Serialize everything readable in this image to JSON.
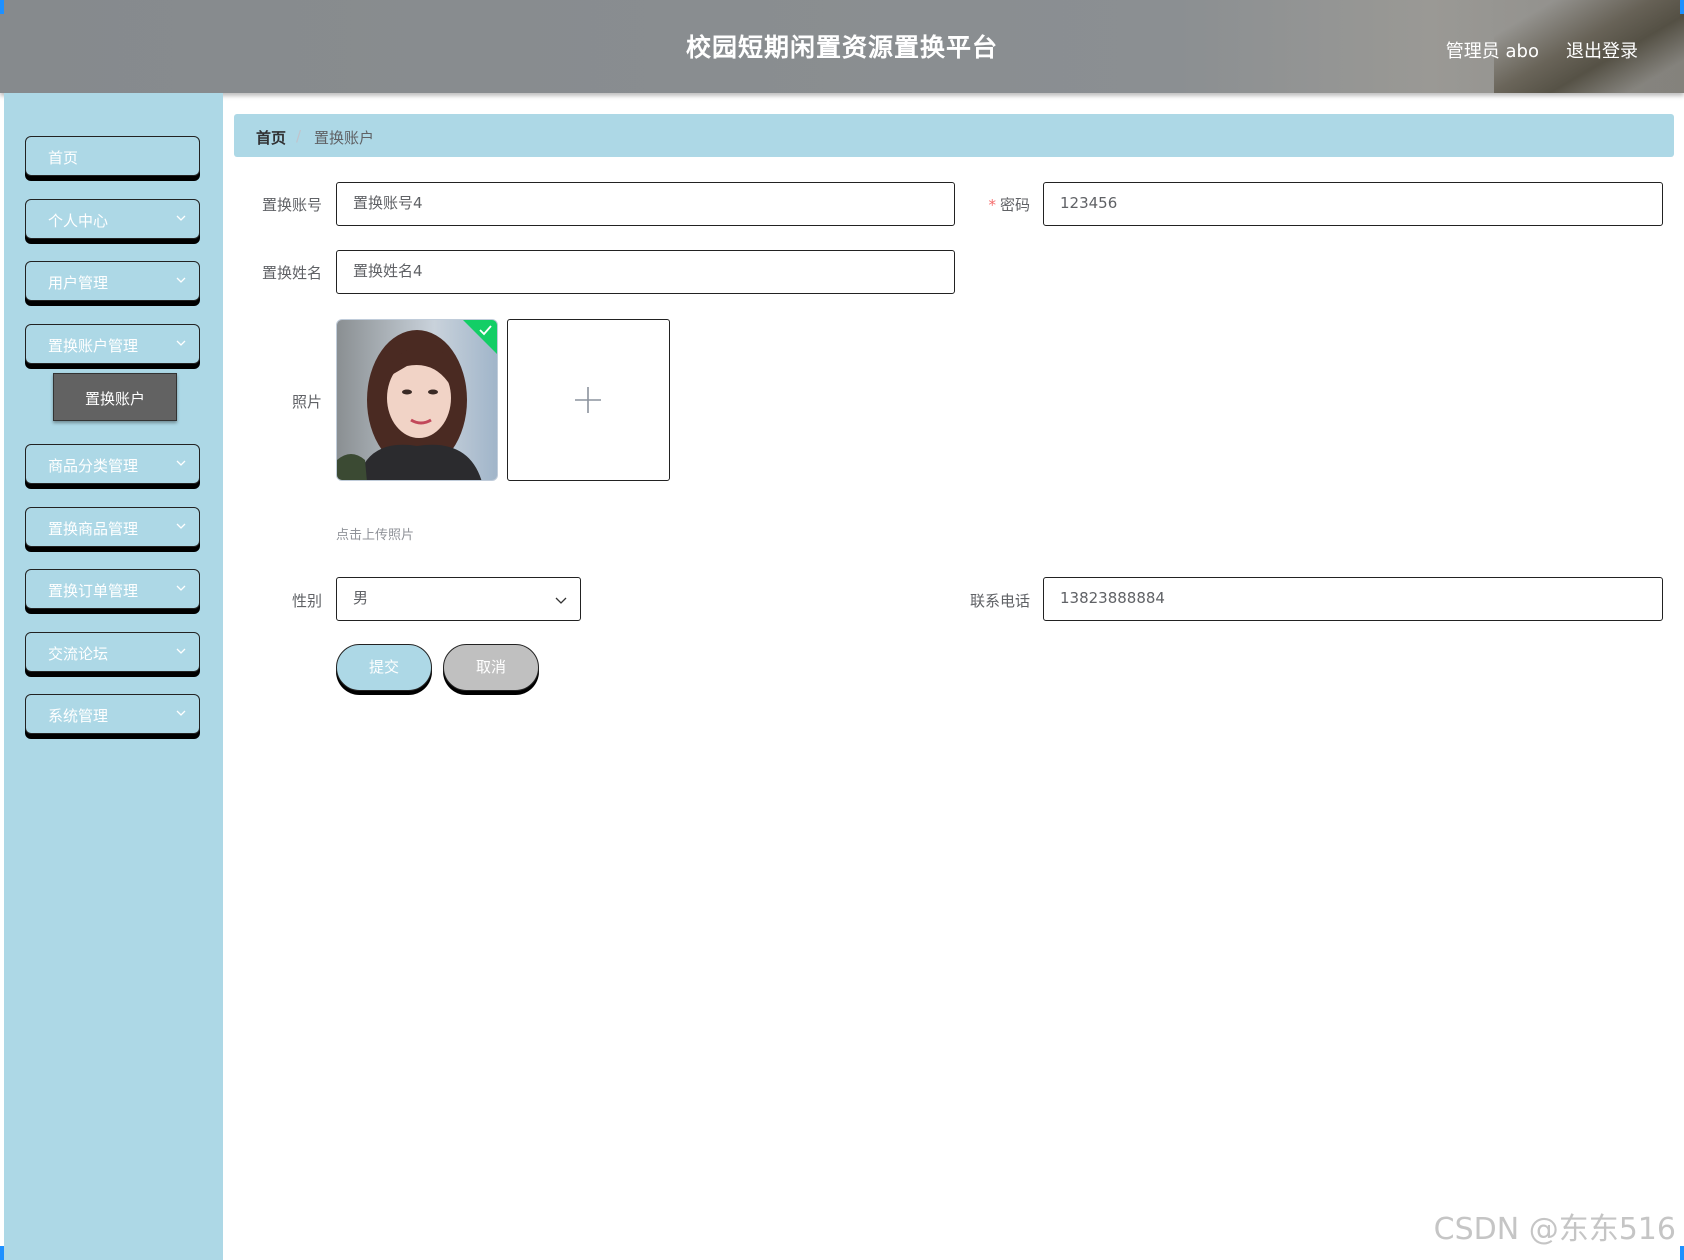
{
  "header": {
    "title": "校园短期闲置资源置换平台",
    "user_label": "管理员 abo",
    "logout_label": "退出登录"
  },
  "sidebar": {
    "items": [
      {
        "label": "首页",
        "has_submenu": false
      },
      {
        "label": "个人中心",
        "has_submenu": true
      },
      {
        "label": "用户管理",
        "has_submenu": true
      },
      {
        "label": "置换账户管理",
        "has_submenu": true,
        "expanded": true
      },
      {
        "label": "商品分类管理",
        "has_submenu": true
      },
      {
        "label": "置换商品管理",
        "has_submenu": true
      },
      {
        "label": "置换订单管理",
        "has_submenu": true
      },
      {
        "label": "交流论坛",
        "has_submenu": true
      },
      {
        "label": "系统管理",
        "has_submenu": true
      }
    ],
    "active_submenu": "置换账户"
  },
  "breadcrumb": {
    "home": "首页",
    "separator": "/",
    "current": "置换账户"
  },
  "form": {
    "account": {
      "label": "置换账号",
      "value": "置换账号4"
    },
    "password": {
      "label": "密码",
      "required_mark": "*",
      "value": "123456"
    },
    "name": {
      "label": "置换姓名",
      "value": "置换姓名4"
    },
    "photo": {
      "label": "照片",
      "tip": "点击上传照片",
      "add_symbol": "+"
    },
    "gender": {
      "label": "性别",
      "value": "男"
    },
    "phone": {
      "label": "联系电话",
      "value": "13823888884"
    },
    "submit_label": "提交",
    "cancel_label": "取消"
  },
  "watermark": "CSDN @东东516",
  "colors": {
    "accent": "#add8e6",
    "header_bg": "#8b8f92",
    "active_submenu_bg": "#626262",
    "cancel_bg": "#c0c0c0",
    "success": "#13ce66"
  }
}
